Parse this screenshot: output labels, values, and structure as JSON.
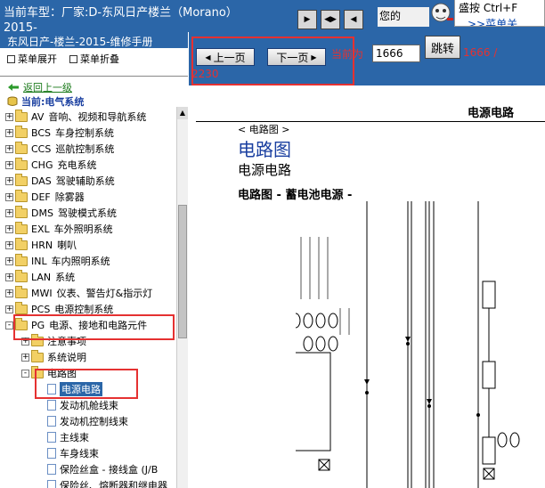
{
  "header": {
    "car_label": "当前车型：",
    "car_value": "厂家:D-东风日产楼兰（Morano）",
    "car_year": "2015-",
    "hint_left": "您的",
    "hint_line1": "盛按 Ctrl+F",
    "hint_menu": ">>菜单关"
  },
  "sidebar": {
    "title": "东风日产-楼兰-2015-维修手册",
    "expand_all": "菜单展开",
    "collapse_all": "菜单折叠",
    "up_level": "返回上一级",
    "current": "当前:电气系统",
    "items": [
      {
        "code": "AV",
        "label": "音响、视频和导航系统",
        "depth": 0,
        "pm": "+",
        "type": "folder"
      },
      {
        "code": "BCS",
        "label": "车身控制系统",
        "depth": 0,
        "pm": "+",
        "type": "folder"
      },
      {
        "code": "CCS",
        "label": "巡航控制系统",
        "depth": 0,
        "pm": "+",
        "type": "folder"
      },
      {
        "code": "CHG",
        "label": "充电系统",
        "depth": 0,
        "pm": "+",
        "type": "folder"
      },
      {
        "code": "DAS",
        "label": "驾驶辅助系统",
        "depth": 0,
        "pm": "+",
        "type": "folder"
      },
      {
        "code": "DEF",
        "label": "除雾器",
        "depth": 0,
        "pm": "+",
        "type": "folder"
      },
      {
        "code": "DMS",
        "label": "驾驶模式系统",
        "depth": 0,
        "pm": "+",
        "type": "folder"
      },
      {
        "code": "EXL",
        "label": "车外照明系统",
        "depth": 0,
        "pm": "+",
        "type": "folder"
      },
      {
        "code": "HRN",
        "label": "喇叭",
        "depth": 0,
        "pm": "+",
        "type": "folder"
      },
      {
        "code": "INL",
        "label": "车内照明系统",
        "depth": 0,
        "pm": "+",
        "type": "folder"
      },
      {
        "code": "LAN",
        "label": "系统",
        "depth": 0,
        "pm": "+",
        "type": "folder"
      },
      {
        "code": "MWI",
        "label": "仪表、警告灯&指示灯",
        "depth": 0,
        "pm": "+",
        "type": "folder"
      },
      {
        "code": "PCS",
        "label": "电源控制系统",
        "depth": 0,
        "pm": "+",
        "type": "folder"
      },
      {
        "code": "PG",
        "label": "电源、接地和电路元件",
        "depth": 0,
        "pm": "-",
        "type": "folder"
      },
      {
        "code": "",
        "label": "注意事项",
        "depth": 1,
        "pm": "+",
        "type": "folder"
      },
      {
        "code": "",
        "label": "系统说明",
        "depth": 1,
        "pm": "+",
        "type": "folder"
      },
      {
        "code": "",
        "label": "电路图",
        "depth": 1,
        "pm": "-",
        "type": "folder"
      },
      {
        "code": "",
        "label": "电源电路",
        "depth": 2,
        "pm": "",
        "type": "doc",
        "selected": true
      },
      {
        "code": "",
        "label": "发动机舱线束",
        "depth": 2,
        "pm": "",
        "type": "doc"
      },
      {
        "code": "",
        "label": "发动机控制线束",
        "depth": 2,
        "pm": "",
        "type": "doc"
      },
      {
        "code": "",
        "label": "主线束",
        "depth": 2,
        "pm": "",
        "type": "doc"
      },
      {
        "code": "",
        "label": "车身线束",
        "depth": 2,
        "pm": "",
        "type": "doc"
      },
      {
        "code": "",
        "label": "保险丝盒 - 接线盒 (J/B",
        "depth": 2,
        "pm": "",
        "type": "doc"
      },
      {
        "code": "",
        "label": "保险丝、熔断器和继电器",
        "depth": 2,
        "pm": "",
        "type": "doc"
      }
    ]
  },
  "pager": {
    "prev": "上一页",
    "next": "下一页",
    "current_label": "当前为",
    "current_value": "1666",
    "jump": "跳转",
    "total_a": "1666 /",
    "total_b": "2230"
  },
  "document": {
    "header": "电源电路",
    "crumb": "< 电路图 >",
    "h1": "电路图",
    "h2": "电源电路",
    "h3": "电路图 - 蓄电池电源 -"
  },
  "colors": {
    "header_blue": "#2b66a8",
    "highlight_red": "#e53131",
    "link_green": "#1a7a1a",
    "title_blue": "#1a3fa0"
  }
}
